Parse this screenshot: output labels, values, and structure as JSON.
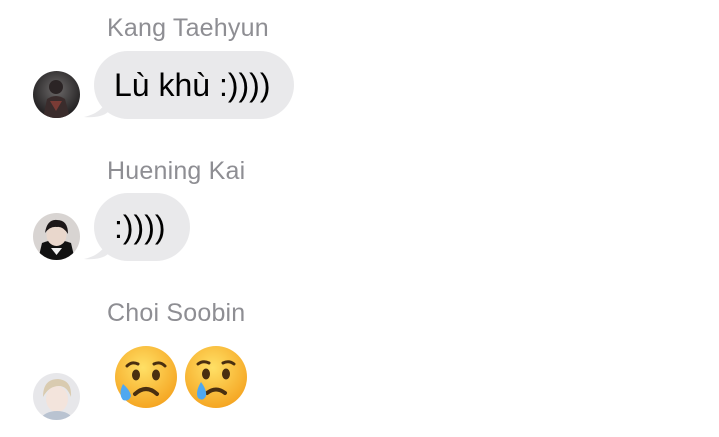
{
  "messages": [
    {
      "sender": "Kang Taehyun",
      "text": "Lù khù :))))",
      "avatar_icon": "avatar-dark-photo"
    },
    {
      "sender": "Huening Kai",
      "text": ":))))",
      "avatar_icon": "avatar-dark-hair-photo"
    },
    {
      "sender": "Choi Soobin",
      "emojis": [
        "sad-but-relieved-face-emoji",
        "crying-face-emoji"
      ],
      "avatar_icon": "avatar-blond-photo"
    }
  ],
  "colors": {
    "bubble": "#e9e9eb",
    "sender_name": "#8e8e93",
    "background": "#ffffff"
  }
}
